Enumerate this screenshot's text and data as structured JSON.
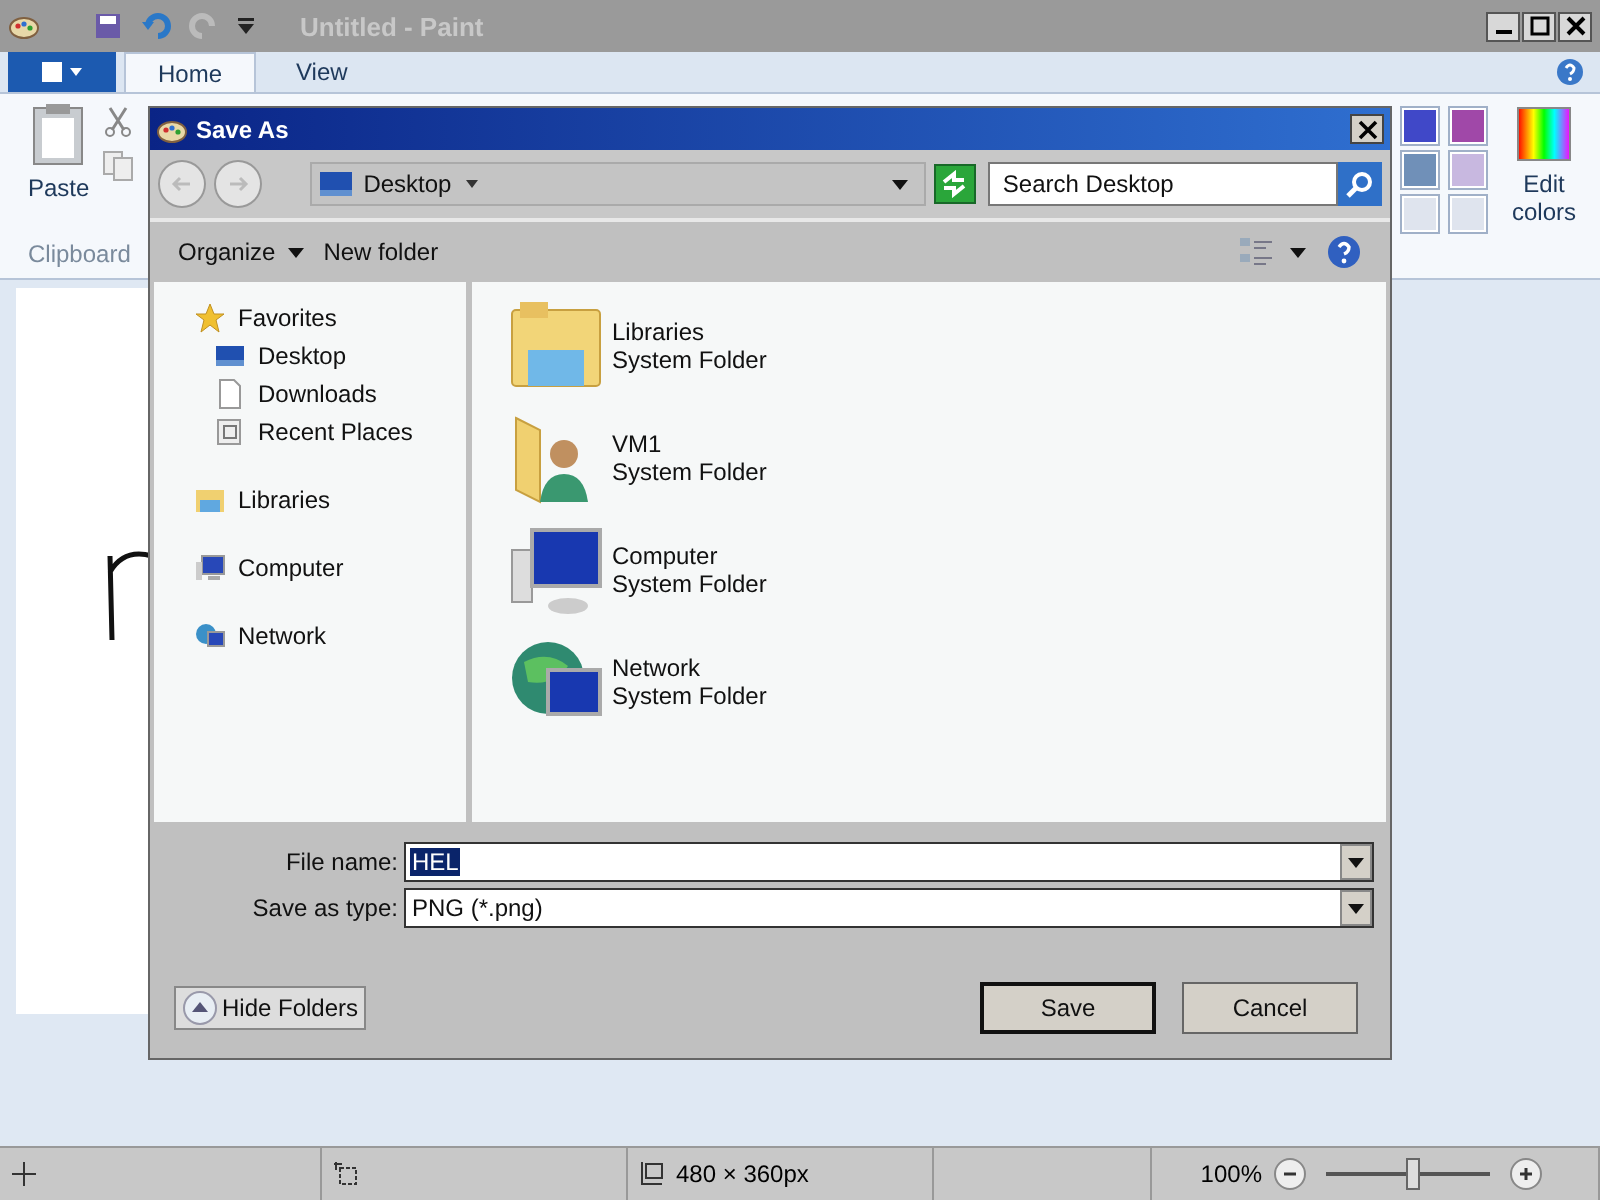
{
  "paint": {
    "title": "Untitled - Paint",
    "tabs": [
      {
        "label": "Home",
        "selected": true
      },
      {
        "label": "View",
        "selected": false
      }
    ],
    "paste": "Paste",
    "clipboard": "Clipboard",
    "edit_colors": "Edit colors",
    "palette": [
      {
        "color": "#4048c8"
      },
      {
        "color": "#a048a8"
      },
      {
        "color": "#7090b8"
      },
      {
        "color": "#c8b8e0"
      },
      {
        "color": "#dfe4ee"
      },
      {
        "color": "#dfe4ee"
      }
    ]
  },
  "dialog": {
    "title": "Save As",
    "location": "Desktop",
    "search": {
      "placeholder": "Search Desktop"
    },
    "toolbar": [
      {
        "label": "Organize",
        "kind": "menu"
      },
      {
        "label": "New folder",
        "kind": "button"
      }
    ],
    "nav": [
      {
        "label": "Favorites",
        "children": [
          {
            "label": "Desktop"
          },
          {
            "label": "Downloads"
          },
          {
            "label": "Recent Places"
          }
        ]
      },
      {
        "label": "Libraries"
      },
      {
        "label": "Computer"
      },
      {
        "label": "Network"
      }
    ],
    "items": [
      {
        "name": "Libraries",
        "type": "System Folder"
      },
      {
        "name": "VM1",
        "type": "System Folder"
      },
      {
        "name": "Computer",
        "type": "System Folder"
      },
      {
        "name": "Network",
        "type": "System Folder"
      }
    ],
    "file_name": {
      "label": "File name:",
      "value": "HEL",
      "selected": true
    },
    "save_type": {
      "label": "Save as type:",
      "value": "PNG (*.png)"
    },
    "hide_folders": "Hide Folders",
    "buttons": [
      {
        "label": "Save",
        "default": true
      },
      {
        "label": "Cancel",
        "default": false
      }
    ]
  },
  "status_bar": {
    "size": "480 × 360px",
    "zoom": {
      "reading": "100%",
      "level": 0.54
    }
  }
}
